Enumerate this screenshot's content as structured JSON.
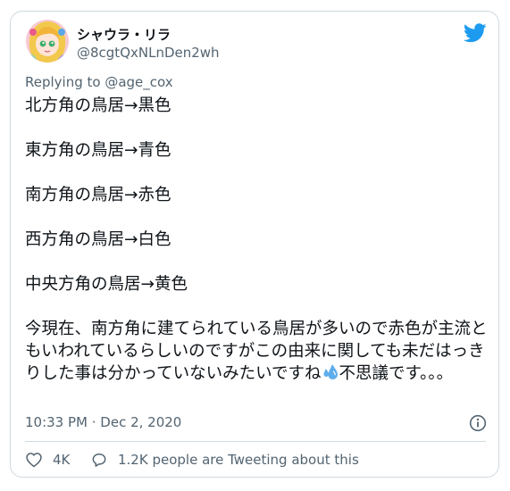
{
  "tweet": {
    "author": {
      "display_name": "シャウラ・リラ",
      "handle": "@8cgtQxNLnDen2wh"
    },
    "replying_to": "Replying to @age_cox",
    "lines": [
      "北方角の鳥居→黒色",
      "東方角の鳥居→青色",
      "南方角の鳥居→赤色",
      "西方角の鳥居→白色",
      "中央方角の鳥居→黄色"
    ],
    "paragraph": {
      "before_emoji": "今現在、南方角に建てられている鳥居が多いので赤色が主流ともいわれているらしいのですがこの由来に関しても未だはっきりした事は分かっていないみたいですね",
      "after_emoji": "不思議です。。。"
    },
    "timestamp": "10:33 PM · Dec 2, 2020"
  },
  "actions": {
    "like_count": "4K",
    "reply_text": "1.2K people are Tweeting about this"
  },
  "colors": {
    "brand": "#1d9bf0",
    "like_heart": "#536471",
    "text_primary": "#0f1419",
    "text_secondary": "#536471"
  },
  "icons": {
    "brand": "twitter-bird-icon",
    "info": "info-icon",
    "like": "heart-icon",
    "reply": "speech-bubble-icon",
    "emoji": "sweat-droplets-emoji"
  }
}
